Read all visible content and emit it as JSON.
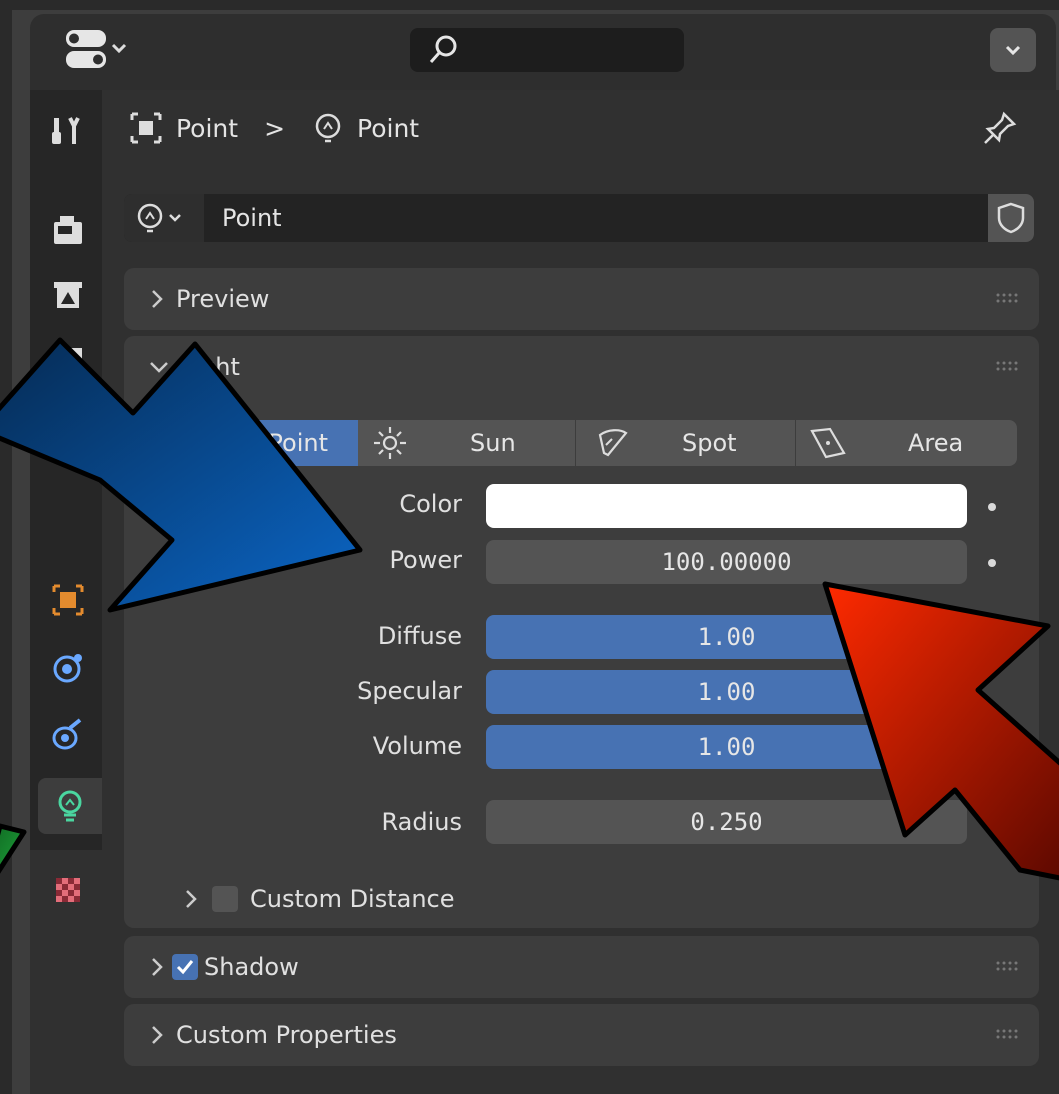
{
  "colors": {
    "accent": "#4772b3",
    "panel": "#3d3d3d",
    "field": "#545454",
    "arrow_blue": "#0a5fb4",
    "arrow_red": "#e02400",
    "arrow_green": "#1fa33a"
  },
  "breadcrumb": {
    "object": "Point",
    "separator": ">",
    "data": "Point"
  },
  "datablock": {
    "name": "Point"
  },
  "panels": {
    "preview": "Preview",
    "light": "Light",
    "shadow": "Shadow",
    "custom_properties": "Custom Properties"
  },
  "light_types": [
    "Point",
    "Sun",
    "Spot",
    "Area"
  ],
  "fields": {
    "color_label": "Color",
    "power_label": "Power",
    "power_value": "100.00000",
    "diffuse_label": "Diffuse",
    "diffuse_value": "1.00",
    "specular_label": "Specular",
    "specular_value": "1.00",
    "volume_label": "Volume",
    "volume_value": "1.00",
    "radius_label": "Radius",
    "radius_value": "0.250"
  },
  "custom_distance": "Custom Distance",
  "icons": [
    "editor-type-icon",
    "search-icon",
    "pin-icon",
    "tool-icon",
    "render-icon",
    "output-icon",
    "view-layer-icon",
    "object-icon",
    "physics-icon",
    "constraints-icon",
    "light-data-icon",
    "texture-icon",
    "shield-icon"
  ]
}
